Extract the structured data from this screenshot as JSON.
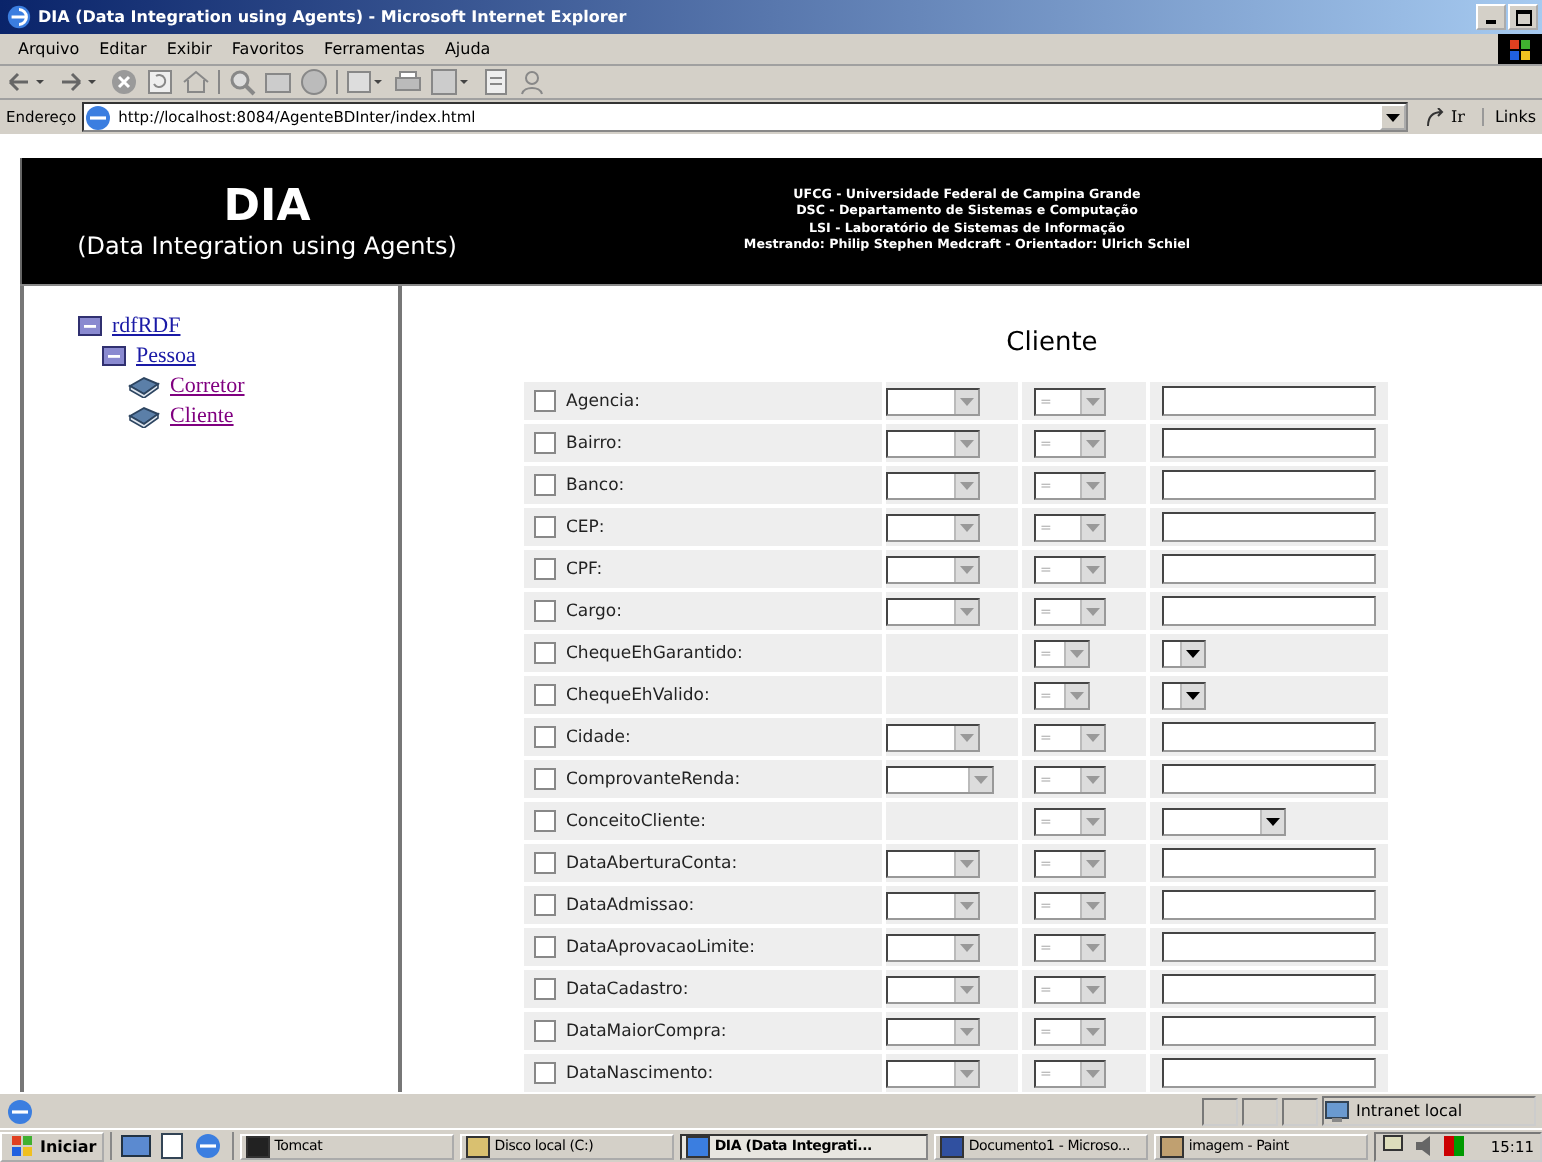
{
  "window": {
    "title": "DIA (Data Integration using Agents) - Microsoft Internet Explorer"
  },
  "menu": [
    "Arquivo",
    "Editar",
    "Exibir",
    "Favoritos",
    "Ferramentas",
    "Ajuda"
  ],
  "address_bar": {
    "label": "Endereço",
    "value": "http://localhost:8084/AgenteBDInter/index.html",
    "go": "Ir",
    "links": "Links"
  },
  "header": {
    "title": "DIA",
    "subtitle": "(Data Integration using Agents)",
    "credits": [
      "UFCG - Universidade Federal de Campina Grande",
      "DSC - Departamento de Sistemas e Computação",
      "LSI - Laboratório de Sistemas de Informação",
      "Mestrando: Philip Stephen Medcraft - Orientador: Ulrich Schiel"
    ]
  },
  "tree": [
    {
      "label": "rdfRDF",
      "expanded": true,
      "children": [
        {
          "label": "Pessoa",
          "expanded": true,
          "children": [
            {
              "label": "Corretor",
              "visited": true
            },
            {
              "label": "Cliente",
              "visited": true
            }
          ]
        }
      ]
    }
  ],
  "form": {
    "title": "Cliente",
    "rows": [
      {
        "label": "Agencia:",
        "kind": "text",
        "checked": false,
        "operator": "="
      },
      {
        "label": "Bairro:",
        "kind": "text",
        "checked": false,
        "operator": "="
      },
      {
        "label": "Banco:",
        "kind": "text",
        "checked": false,
        "operator": "="
      },
      {
        "label": "CEP:",
        "kind": "text",
        "checked": false,
        "operator": "="
      },
      {
        "label": "CPF:",
        "kind": "text",
        "checked": false,
        "operator": "="
      },
      {
        "label": "Cargo:",
        "kind": "text",
        "checked": false,
        "operator": "="
      },
      {
        "label": "ChequeEhGarantido:",
        "kind": "bool",
        "checked": false,
        "operator": "="
      },
      {
        "label": "ChequeEhValido:",
        "kind": "bool",
        "checked": false,
        "operator": "="
      },
      {
        "label": "Cidade:",
        "kind": "text",
        "checked": false,
        "operator": "="
      },
      {
        "label": "ComprovanteRenda:",
        "kind": "text",
        "checked": false,
        "operator": "="
      },
      {
        "label": "ConceitoCliente:",
        "kind": "enum",
        "checked": false,
        "operator": "="
      },
      {
        "label": "DataAberturaConta:",
        "kind": "text",
        "checked": false,
        "operator": "="
      },
      {
        "label": "DataAdmissao:",
        "kind": "text",
        "checked": false,
        "operator": "="
      },
      {
        "label": "DataAprovacaoLimite:",
        "kind": "text",
        "checked": false,
        "operator": "="
      },
      {
        "label": "DataCadastro:",
        "kind": "text",
        "checked": false,
        "operator": "="
      },
      {
        "label": "DataMaiorCompra:",
        "kind": "text",
        "checked": false,
        "operator": "="
      },
      {
        "label": "DataNascimento:",
        "kind": "text",
        "checked": false,
        "operator": "="
      }
    ]
  },
  "status_bar": {
    "zone": "Intranet local"
  },
  "taskbar": {
    "start": "Iniciar",
    "tasks": [
      {
        "label": "Tomcat",
        "selected": false
      },
      {
        "label": "Disco local (C:)",
        "selected": false
      },
      {
        "label": "DIA (Data Integrati...",
        "selected": true
      },
      {
        "label": "Documento1 - Microso...",
        "selected": false
      },
      {
        "label": "imagem - Paint",
        "selected": false
      }
    ],
    "clock": "15:11"
  }
}
